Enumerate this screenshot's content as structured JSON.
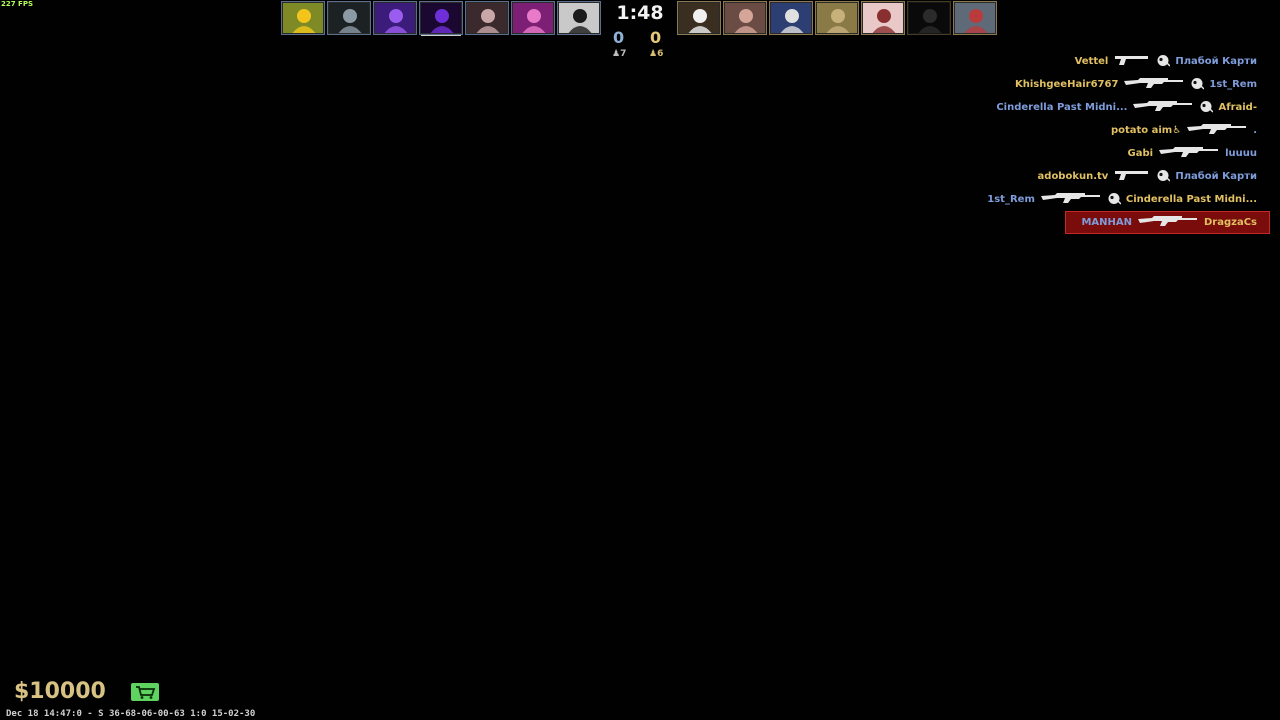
{
  "fps": "227 FPS",
  "clock": "1:48",
  "score": {
    "ct": "0",
    "t": "0"
  },
  "alive": {
    "ct": "7",
    "t": "6"
  },
  "ct_avatars": [
    {
      "name": "ct-avatar-1",
      "bg": "#7d8a25",
      "fg": "#f3c51c"
    },
    {
      "name": "ct-avatar-2",
      "bg": "#1c2224",
      "fg": "#8c9aa5"
    },
    {
      "name": "ct-avatar-3",
      "bg": "#3b1c7a",
      "fg": "#9b5cf0"
    },
    {
      "name": "ct-avatar-4",
      "bg": "#1a0830",
      "fg": "#6f2fd8"
    },
    {
      "name": "ct-avatar-5",
      "bg": "#3a2a2e",
      "fg": "#c9a7a9"
    },
    {
      "name": "ct-avatar-6",
      "bg": "#7c1f75",
      "fg": "#e87ac9"
    },
    {
      "name": "ct-avatar-7",
      "bg": "#c9c9c9",
      "fg": "#1b1b1b"
    }
  ],
  "t_avatars": [
    {
      "name": "t-avatar-1",
      "bg": "#3a2e20",
      "fg": "#f0f0f0"
    },
    {
      "name": "t-avatar-2",
      "bg": "#6b4c44",
      "fg": "#d6a59a"
    },
    {
      "name": "t-avatar-3",
      "bg": "#2d3e72",
      "fg": "#e0e0e0"
    },
    {
      "name": "t-avatar-4",
      "bg": "#8a7a46",
      "fg": "#c8b07a"
    },
    {
      "name": "t-avatar-5",
      "bg": "#e9c8c8",
      "fg": "#8a2f2f"
    },
    {
      "name": "t-avatar-6",
      "bg": "#141414",
      "fg": "#555555"
    },
    {
      "name": "t-avatar-7",
      "bg": "#5f6a78",
      "fg": "#b93b3b"
    }
  ],
  "killfeed": [
    {
      "killer": "Vettel",
      "killer_team": "t",
      "weapon": "pistol",
      "headshot": true,
      "victim": "Плабой Карти",
      "victim_team": "ct",
      "highlight": false
    },
    {
      "killer": "KhishgeeHair6767",
      "killer_team": "t",
      "weapon": "rifle",
      "headshot": true,
      "victim": "1st_Rem",
      "victim_team": "ct",
      "highlight": false
    },
    {
      "killer": "Cinderella Past Midni...",
      "killer_team": "ct",
      "weapon": "rifle",
      "headshot": true,
      "victim": "Afraid-",
      "victim_team": "t",
      "highlight": false
    },
    {
      "killer": "potato aim♿",
      "killer_team": "t",
      "weapon": "rifle",
      "headshot": false,
      "victim": ".",
      "victim_team": "ct",
      "highlight": false
    },
    {
      "killer": "Gabi",
      "killer_team": "t",
      "weapon": "rifle",
      "headshot": false,
      "victim": "luuuu",
      "victim_team": "ct",
      "highlight": false
    },
    {
      "killer": "adobokun.tv",
      "killer_team": "t",
      "weapon": "pistol",
      "headshot": true,
      "victim": "Плабой Карти",
      "victim_team": "ct",
      "highlight": false
    },
    {
      "killer": "1st_Rem",
      "killer_team": "ct",
      "weapon": "rifle",
      "headshot": true,
      "victim": "Cinderella Past Midni...",
      "victim_team": "t",
      "highlight": false
    },
    {
      "killer": "MANHAN",
      "killer_team": "ct",
      "weapon": "rifle",
      "headshot": false,
      "victim": "DragzaCs",
      "victim_team": "t",
      "highlight": true
    }
  ],
  "money": "$10000",
  "demo_info": "Dec 18 14:47:0 - S 36-68-06-00-63 1:0 15-02-30",
  "colors": {
    "ct": "#7f9ddb",
    "t": "#e0c062",
    "money": "#d7c283",
    "buy_icon": "#5fd35f"
  }
}
